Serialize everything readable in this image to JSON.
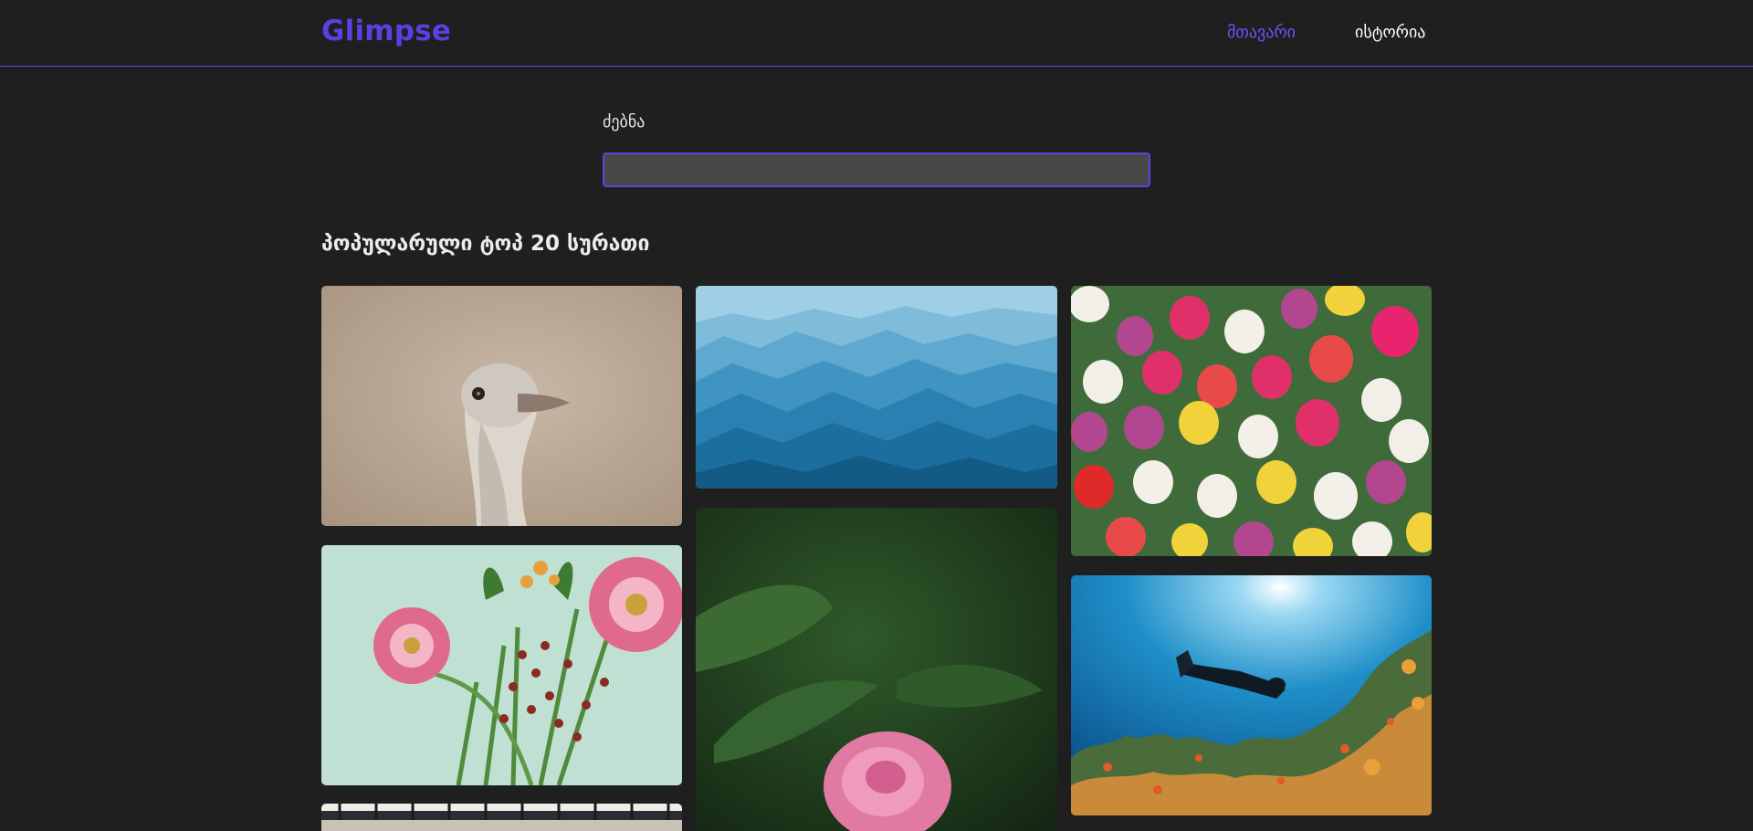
{
  "header": {
    "logo": "Glimpse",
    "nav": {
      "home": "მთავარი",
      "history": "ისტორია"
    },
    "accent_color": "#5b45e0"
  },
  "search": {
    "label": "ძებნა",
    "value": "",
    "placeholder": ""
  },
  "gallery": {
    "title": "პოპულარული ტოპ 20 სურათი",
    "images": [
      {
        "subject": "ostrich"
      },
      {
        "subject": "blue mountains"
      },
      {
        "subject": "tulips"
      },
      {
        "subject": "pink gerbera flowers"
      },
      {
        "subject": "pink peony"
      },
      {
        "subject": "scuba diver over coral reef"
      },
      {
        "subject": "station roof"
      }
    ]
  }
}
